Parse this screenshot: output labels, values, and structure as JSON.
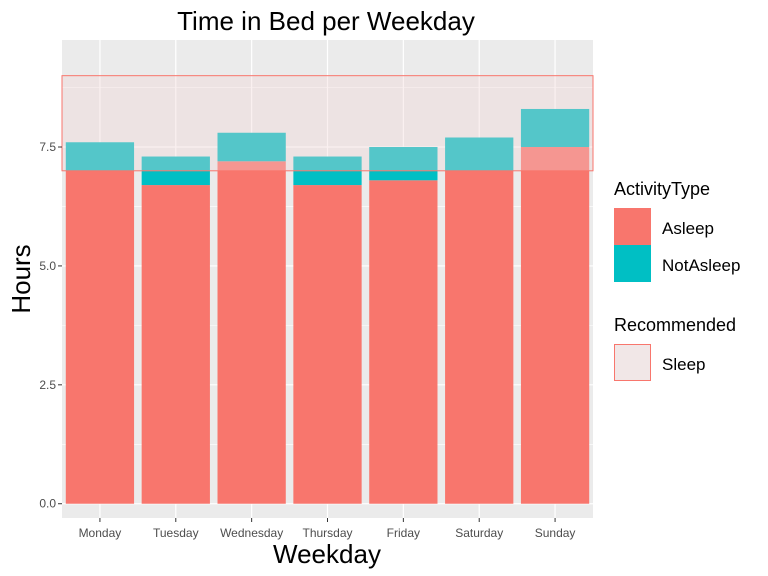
{
  "chart_data": {
    "type": "bar",
    "stacked": true,
    "title": "Time in Bed per Weekday",
    "xlabel": "Weekday",
    "ylabel": "Hours",
    "categories": [
      "Monday",
      "Tuesday",
      "Wednesday",
      "Thursday",
      "Friday",
      "Saturday",
      "Sunday"
    ],
    "series": [
      {
        "name": "Asleep",
        "color": "#F8766D",
        "values": [
          7.0,
          6.7,
          7.2,
          6.7,
          6.8,
          7.0,
          7.5
        ]
      },
      {
        "name": "NotAsleep",
        "color": "#00BFC4",
        "values": [
          0.6,
          0.6,
          0.6,
          0.6,
          0.7,
          0.7,
          0.8
        ]
      }
    ],
    "ylim": [
      -0.3,
      9.75
    ],
    "yticks": [
      0.0,
      2.5,
      5.0,
      7.5
    ],
    "ytick_labels": [
      "0.0",
      "2.5",
      "5.0",
      "7.5"
    ],
    "grid": true,
    "recommended_band": {
      "name": "Sleep",
      "ymin": 7.0,
      "ymax": 9.0,
      "fill": "#F2D4D5",
      "stroke": "#F8766D"
    },
    "legend": {
      "position": "right",
      "activity_title": "ActivityType",
      "recommended_title": "Recommended"
    }
  }
}
